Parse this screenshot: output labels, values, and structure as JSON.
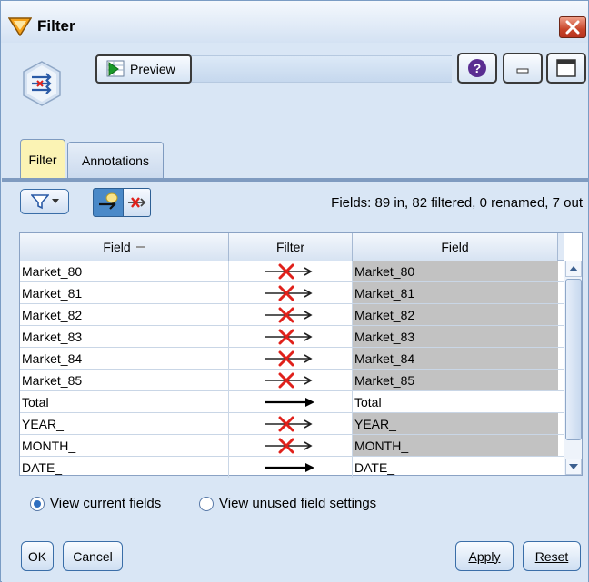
{
  "window": {
    "title": "Filter",
    "close_icon": "close-icon"
  },
  "toolbar": {
    "preview_label": "Preview",
    "help_icon": "help-icon",
    "minimize_icon": "minimize-icon",
    "maximize_icon": "maximize-icon",
    "node_icon": "filter-node-icon"
  },
  "tabs": [
    {
      "label": "Filter",
      "active": true
    },
    {
      "label": "Annotations",
      "active": false
    }
  ],
  "filter_bar": {
    "funnel_icon": "funnel-dropdown-icon",
    "mode_pass_icon": "pass-fields-icon",
    "mode_remove_icon": "remove-fields-icon",
    "summary": "Fields: 89 in, 82 filtered, 0 renamed, 7 out"
  },
  "grid": {
    "columns": [
      "Field",
      "Filter",
      "Field"
    ],
    "rows": [
      {
        "in_field": "Market_80",
        "filtered": true,
        "out_field": "Market_80"
      },
      {
        "in_field": "Market_81",
        "filtered": true,
        "out_field": "Market_81"
      },
      {
        "in_field": "Market_82",
        "filtered": true,
        "out_field": "Market_82"
      },
      {
        "in_field": "Market_83",
        "filtered": true,
        "out_field": "Market_83"
      },
      {
        "in_field": "Market_84",
        "filtered": true,
        "out_field": "Market_84"
      },
      {
        "in_field": "Market_85",
        "filtered": true,
        "out_field": "Market_85"
      },
      {
        "in_field": "Total",
        "filtered": false,
        "out_field": "Total"
      },
      {
        "in_field": "YEAR_",
        "filtered": true,
        "out_field": "YEAR_"
      },
      {
        "in_field": "MONTH_",
        "filtered": true,
        "out_field": "MONTH_"
      },
      {
        "in_field": "DATE_",
        "filtered": false,
        "out_field": "DATE_"
      }
    ]
  },
  "view_options": {
    "current_label": "View current fields",
    "unused_label": "View unused field settings",
    "selected": "current"
  },
  "buttons": {
    "ok": "OK",
    "cancel": "Cancel",
    "apply": "Apply",
    "reset": "Reset"
  },
  "colors": {
    "accent": "#2f6fc0",
    "filtered_cell": "#c2c2c2",
    "filter_x": "#e0211b",
    "active_tab": "#fbf3b4"
  }
}
